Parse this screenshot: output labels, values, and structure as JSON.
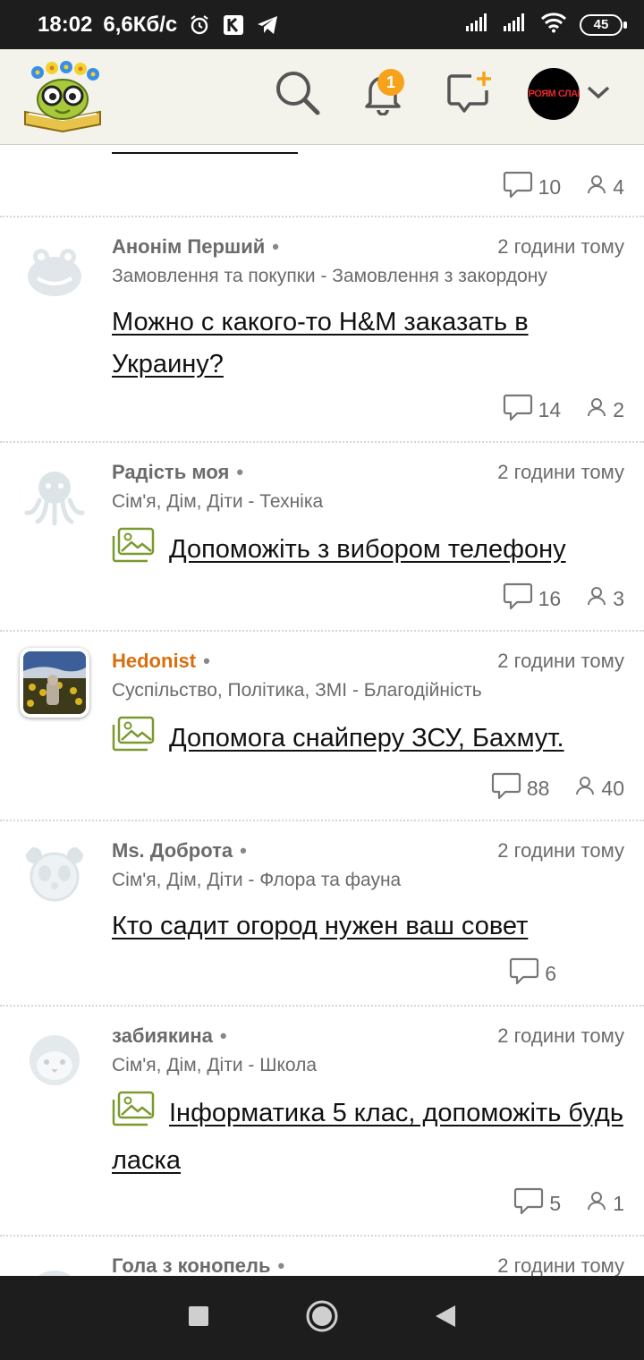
{
  "status_bar": {
    "time": "18:02",
    "speed": "6,6Кб/с",
    "battery": "45"
  },
  "header": {
    "avatar_text": "ГЕРОЯМ СЛАВА",
    "notification_count": "1"
  },
  "partial_top": {
    "comments": "10",
    "participants": "4"
  },
  "posts": [
    {
      "author": "Анонім Перший",
      "time": "2 години тому",
      "category": "Замовлення та покупки - Замовлення з закордону",
      "title": "Можно с какого-то H&M заказать в Украину?",
      "comments": "14",
      "participants": "2"
    },
    {
      "author": "Радість моя",
      "time": "2 години тому",
      "category": "Сім'я, Дім, Діти - Техніка",
      "title": "Допоможіть з вибором телефону",
      "comments": "16",
      "participants": "3"
    },
    {
      "author": "Hedonist",
      "time": "2 години тому",
      "category": "Суспільство, Політика, ЗМІ - Благодійність",
      "title": "Допомога снайперу ЗСУ, Бахмут.",
      "comments": "88",
      "participants": "40"
    },
    {
      "author": "Ms. Доброта",
      "time": "2 години тому",
      "category": "Сім'я, Дім, Діти - Флора та фауна",
      "title": "Кто садит огород нужен ваш совет",
      "comments": "6"
    },
    {
      "author": "забиякина",
      "time": "2 години тому",
      "category": "Сім'я, Дім, Діти - Школа",
      "title": "Інформатика 5 клас, допоможіть будь ласка",
      "comments": "5",
      "participants": "1"
    },
    {
      "author": "Гола з конопель",
      "time": "2 години тому"
    }
  ],
  "colors": {
    "header_bg": "#f3f3eb",
    "badge": "#f7a21b",
    "accent_orange": "#d96f10",
    "image_icon_green": "#7a9a2e"
  }
}
